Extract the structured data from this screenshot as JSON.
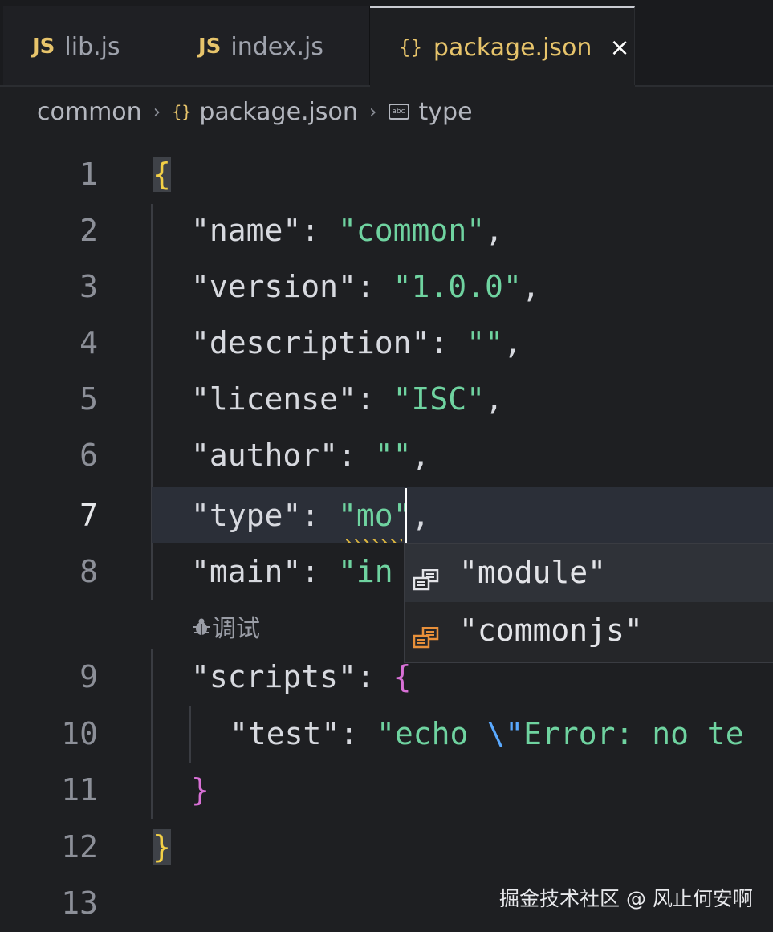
{
  "tabs": [
    {
      "icon": "JS",
      "label": "lib.js"
    },
    {
      "icon": "JS",
      "label": "index.js"
    },
    {
      "icon": "{}",
      "label": "package.json",
      "close": "×"
    }
  ],
  "breadcrumb": {
    "folder": "common",
    "file": "package.json",
    "file_icon": "{}",
    "symbol": "type",
    "symbol_icon": "abc"
  },
  "editor": {
    "current_line": 7,
    "lines": [
      {
        "num": "1"
      },
      {
        "num": "2",
        "key": "\"name\"",
        "value": "\"common\""
      },
      {
        "num": "3",
        "key": "\"version\"",
        "value": "\"1.0.0\""
      },
      {
        "num": "4",
        "key": "\"description\"",
        "value": "\"\""
      },
      {
        "num": "5",
        "key": "\"license\"",
        "value": "\"ISC\""
      },
      {
        "num": "6",
        "key": "\"author\"",
        "value": "\"\""
      },
      {
        "num": "7",
        "key": "\"type\"",
        "value": "\"mo",
        "value_tail": "\""
      },
      {
        "num": "8",
        "key": "\"main\"",
        "value": "\"in"
      },
      {
        "num": "9",
        "key": "\"scripts\""
      },
      {
        "num": "10",
        "key": "\"test\"",
        "value": "\"echo ",
        "escape": "\\\"",
        "value_tail": "Error: no te"
      },
      {
        "num": "11"
      },
      {
        "num": "12"
      },
      {
        "num": "13"
      }
    ],
    "codelens": "调试",
    "suggestions": [
      {
        "label": "\"module\"",
        "icon": "enum-member-icon",
        "color": "#e3e4e8"
      },
      {
        "label": "\"commonjs\"",
        "icon": "enum-member-icon",
        "color": "#e8903a"
      }
    ]
  },
  "colors": {
    "string": "#6fd3a0",
    "key": "#d7d9df",
    "brace_outer": "#f3d046",
    "brace_inner": "#d870d6",
    "accent_tab": "#e7c46b"
  },
  "watermark": "掘金技术社区 @ 风止何安啊"
}
